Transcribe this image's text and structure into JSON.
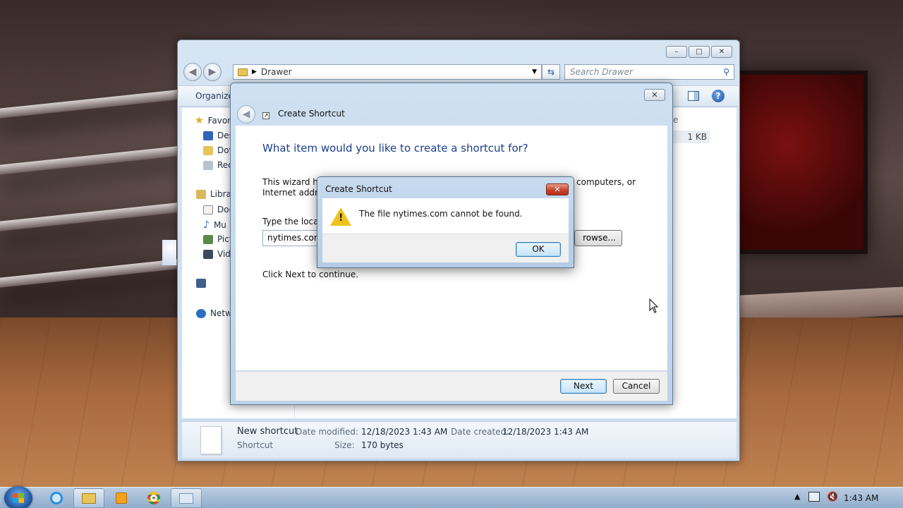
{
  "explorer": {
    "title_controls": {
      "minimize": "–",
      "maximize": "□",
      "close": "✕"
    },
    "address": "Drawer",
    "search_placeholder": "Search Drawer",
    "toolbar": {
      "organize_label": "Organize"
    },
    "nav": {
      "favorites": "Favor",
      "desktop": "Des",
      "downloads": "Dov",
      "recent": "Rec",
      "libraries": "Libra",
      "documents": "Doc",
      "music": "Mu",
      "pictures": "Pict",
      "videos": "Vid",
      "network": "Netw"
    },
    "column_header_fragment": "e",
    "size_cell": "1 KB",
    "details": {
      "name": "New shortcut",
      "type": "Shortcut",
      "date_modified_label": "Date modified:",
      "date_modified": "12/18/2023 1:43 AM",
      "date_created_label": "Date created:",
      "date_created": "12/18/2023 1:43 AM",
      "size_label": "Size:",
      "size": "170 bytes"
    }
  },
  "wizard": {
    "title": "Create Shortcut",
    "heading": "What item would you like to create a shortcut for?",
    "intro_left": "This wizard hel",
    "intro_right": "computers, or",
    "intro_line2": "Internet addres",
    "location_label": "Type the locati",
    "location_value": "nytimes.com",
    "browse_label": "rowse...",
    "continue_text": "Click Next to continue.",
    "next_label": "Next",
    "cancel_label": "Cancel",
    "close_symbol": "✕"
  },
  "message_box": {
    "title": "Create Shortcut",
    "message": "The file nytimes.com cannot be found.",
    "ok_label": "OK",
    "close_symbol": "✕"
  },
  "taskbar": {
    "clock": "1:43 AM",
    "tray_arrow": "▲"
  }
}
